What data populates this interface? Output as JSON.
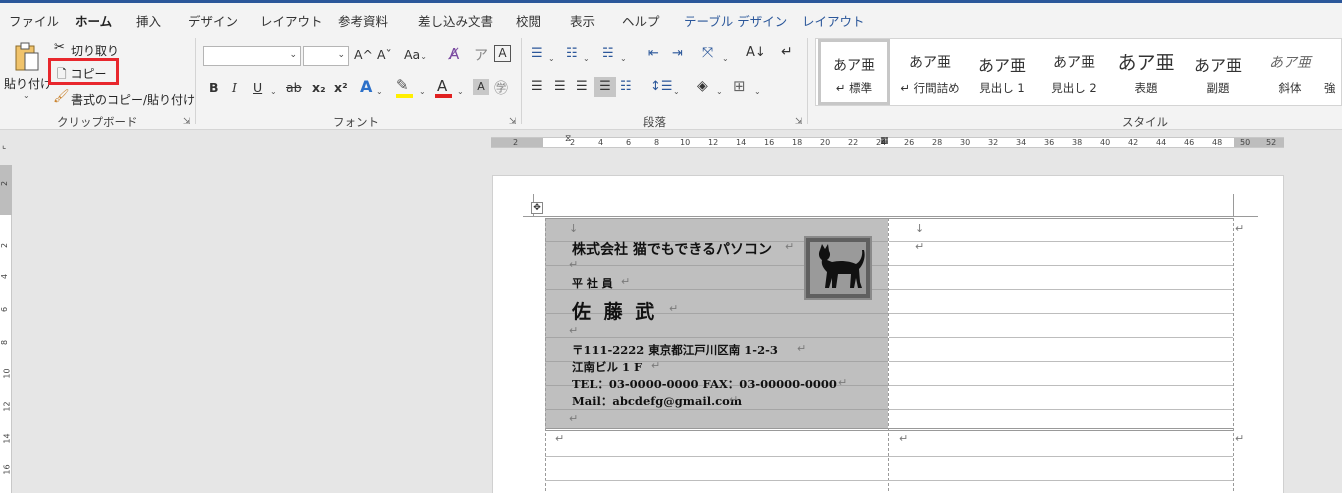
{
  "tabs": [
    {
      "label": "ファイル",
      "active": false
    },
    {
      "label": "ホーム",
      "active": true
    },
    {
      "label": "挿入",
      "active": false
    },
    {
      "label": "デザイン",
      "active": false
    },
    {
      "label": "レイアウト",
      "active": false
    },
    {
      "label": "参考資料",
      "active": false
    },
    {
      "label": "差し込み文書",
      "active": false
    },
    {
      "label": "校閲",
      "active": false
    },
    {
      "label": "表示",
      "active": false
    },
    {
      "label": "ヘルプ",
      "active": false
    },
    {
      "label": "テーブル デザイン",
      "active": false,
      "contextual": true
    },
    {
      "label": "レイアウト",
      "active": false,
      "contextual": true
    }
  ],
  "clipboard": {
    "paste_label": "貼り付け",
    "cut_label": "切り取り",
    "copy_label": "コピー",
    "format_painter_label": "書式のコピー/貼り付け",
    "group_label": "クリップボード"
  },
  "font": {
    "font_name": "",
    "font_size": "",
    "group_label": "フォント",
    "grow_label": "A^",
    "shrink_label": "Aˇ",
    "case_label": "Aa",
    "bold": "B",
    "italic": "I",
    "underline": "U",
    "strike": "ab",
    "subscript": "x₂",
    "superscript": "x²"
  },
  "paragraph": {
    "group_label": "段落"
  },
  "styles": {
    "group_label": "スタイル",
    "items": [
      {
        "preview": "あア亜",
        "name": "↵ 標準",
        "selected": true
      },
      {
        "preview": "あア亜",
        "name": "↵ 行間詰め",
        "selected": false
      },
      {
        "preview": "あア亜",
        "name": "見出し 1",
        "selected": false
      },
      {
        "preview": "あア亜",
        "name": "見出し 2",
        "selected": false
      },
      {
        "preview": "あア亜",
        "name": "表題",
        "selected": false
      },
      {
        "preview": "あア亜",
        "name": "副題",
        "selected": false
      },
      {
        "preview": "あア亜",
        "name": "斜体",
        "selected": false
      },
      {
        "preview": "",
        "name": "強",
        "selected": false
      }
    ]
  },
  "ruler": {
    "numbers": [
      "2",
      "2",
      "4",
      "6",
      "8",
      "10",
      "12",
      "14",
      "16",
      "18",
      "20",
      "22",
      "24",
      "26",
      "28",
      "30",
      "32",
      "34",
      "36",
      "38",
      "40",
      "42",
      "44",
      "46",
      "48",
      "50",
      "52"
    ],
    "vertical_numbers": [
      "2",
      "2",
      "4",
      "6",
      "8",
      "10",
      "12",
      "14",
      "16"
    ]
  },
  "card": {
    "company": "株式会社 猫でもできるパソコン",
    "position": "平 社 員",
    "name": "佐 藤  武",
    "address1": "〒111-2222 東京都江戸川区南 1-2-3",
    "address2": "江南ビル 1 F",
    "tel": "TEL：03-0000-0000 FAX：03-00000-0000",
    "mail": "Mail：abcdefg@gmail.com"
  },
  "colors": {
    "accent": "#2b579a",
    "highlight_box": "#e8272d",
    "card_bg": "#bfbfbf"
  }
}
